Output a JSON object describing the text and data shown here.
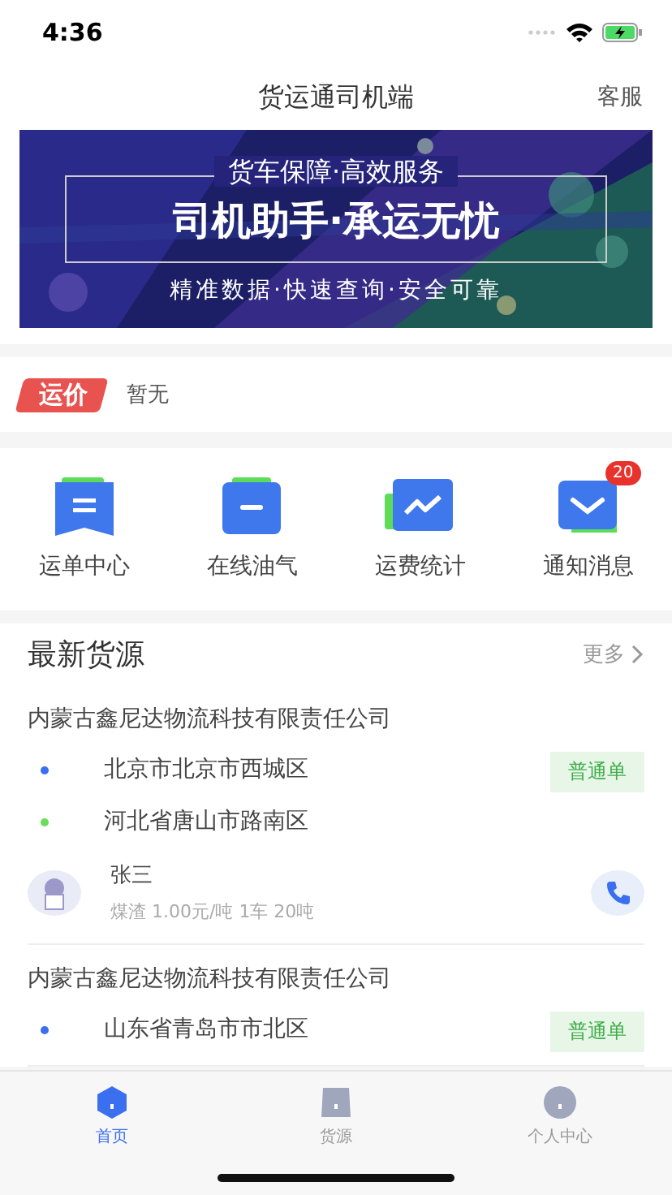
{
  "status_bar": {
    "time": "4:36"
  },
  "nav": {
    "title": "货运通司机端",
    "action": "客服"
  },
  "banner": {
    "lines": [
      "货车保障·高效服务",
      "司机助手·承运无忧",
      "精准数据·快速查询·安全可靠"
    ]
  },
  "price": {
    "tag": "运价",
    "value": "暂无"
  },
  "shortcuts": [
    {
      "label": "运单中心"
    },
    {
      "label": "在线油气"
    },
    {
      "label": "运费统计"
    },
    {
      "label": "通知消息",
      "badge": "20"
    }
  ],
  "section": {
    "title": "最新货源",
    "more": "更多"
  },
  "cargo": [
    {
      "company": "内蒙古鑫尼达物流科技有限责任公司",
      "tag": "普通单",
      "stops": [
        {
          "address": "北京市北京市西城区",
          "color": "#3a6ff0"
        },
        {
          "address": "河北省唐山市路南区",
          "color": "#6ddc5c"
        }
      ],
      "contact": {
        "name": "张三",
        "detail": "煤渣 1.00元/吨 1车 20吨"
      }
    },
    {
      "company": "内蒙古鑫尼达物流科技有限责任公司",
      "tag": "普通单",
      "stops": [
        {
          "address": "山东省青岛市市北区",
          "color": "#3a6ff0"
        }
      ]
    }
  ],
  "tabs": [
    {
      "label": "首页",
      "selected": true
    },
    {
      "label": "货源",
      "selected": false
    },
    {
      "label": "个人中心",
      "selected": false
    }
  ]
}
